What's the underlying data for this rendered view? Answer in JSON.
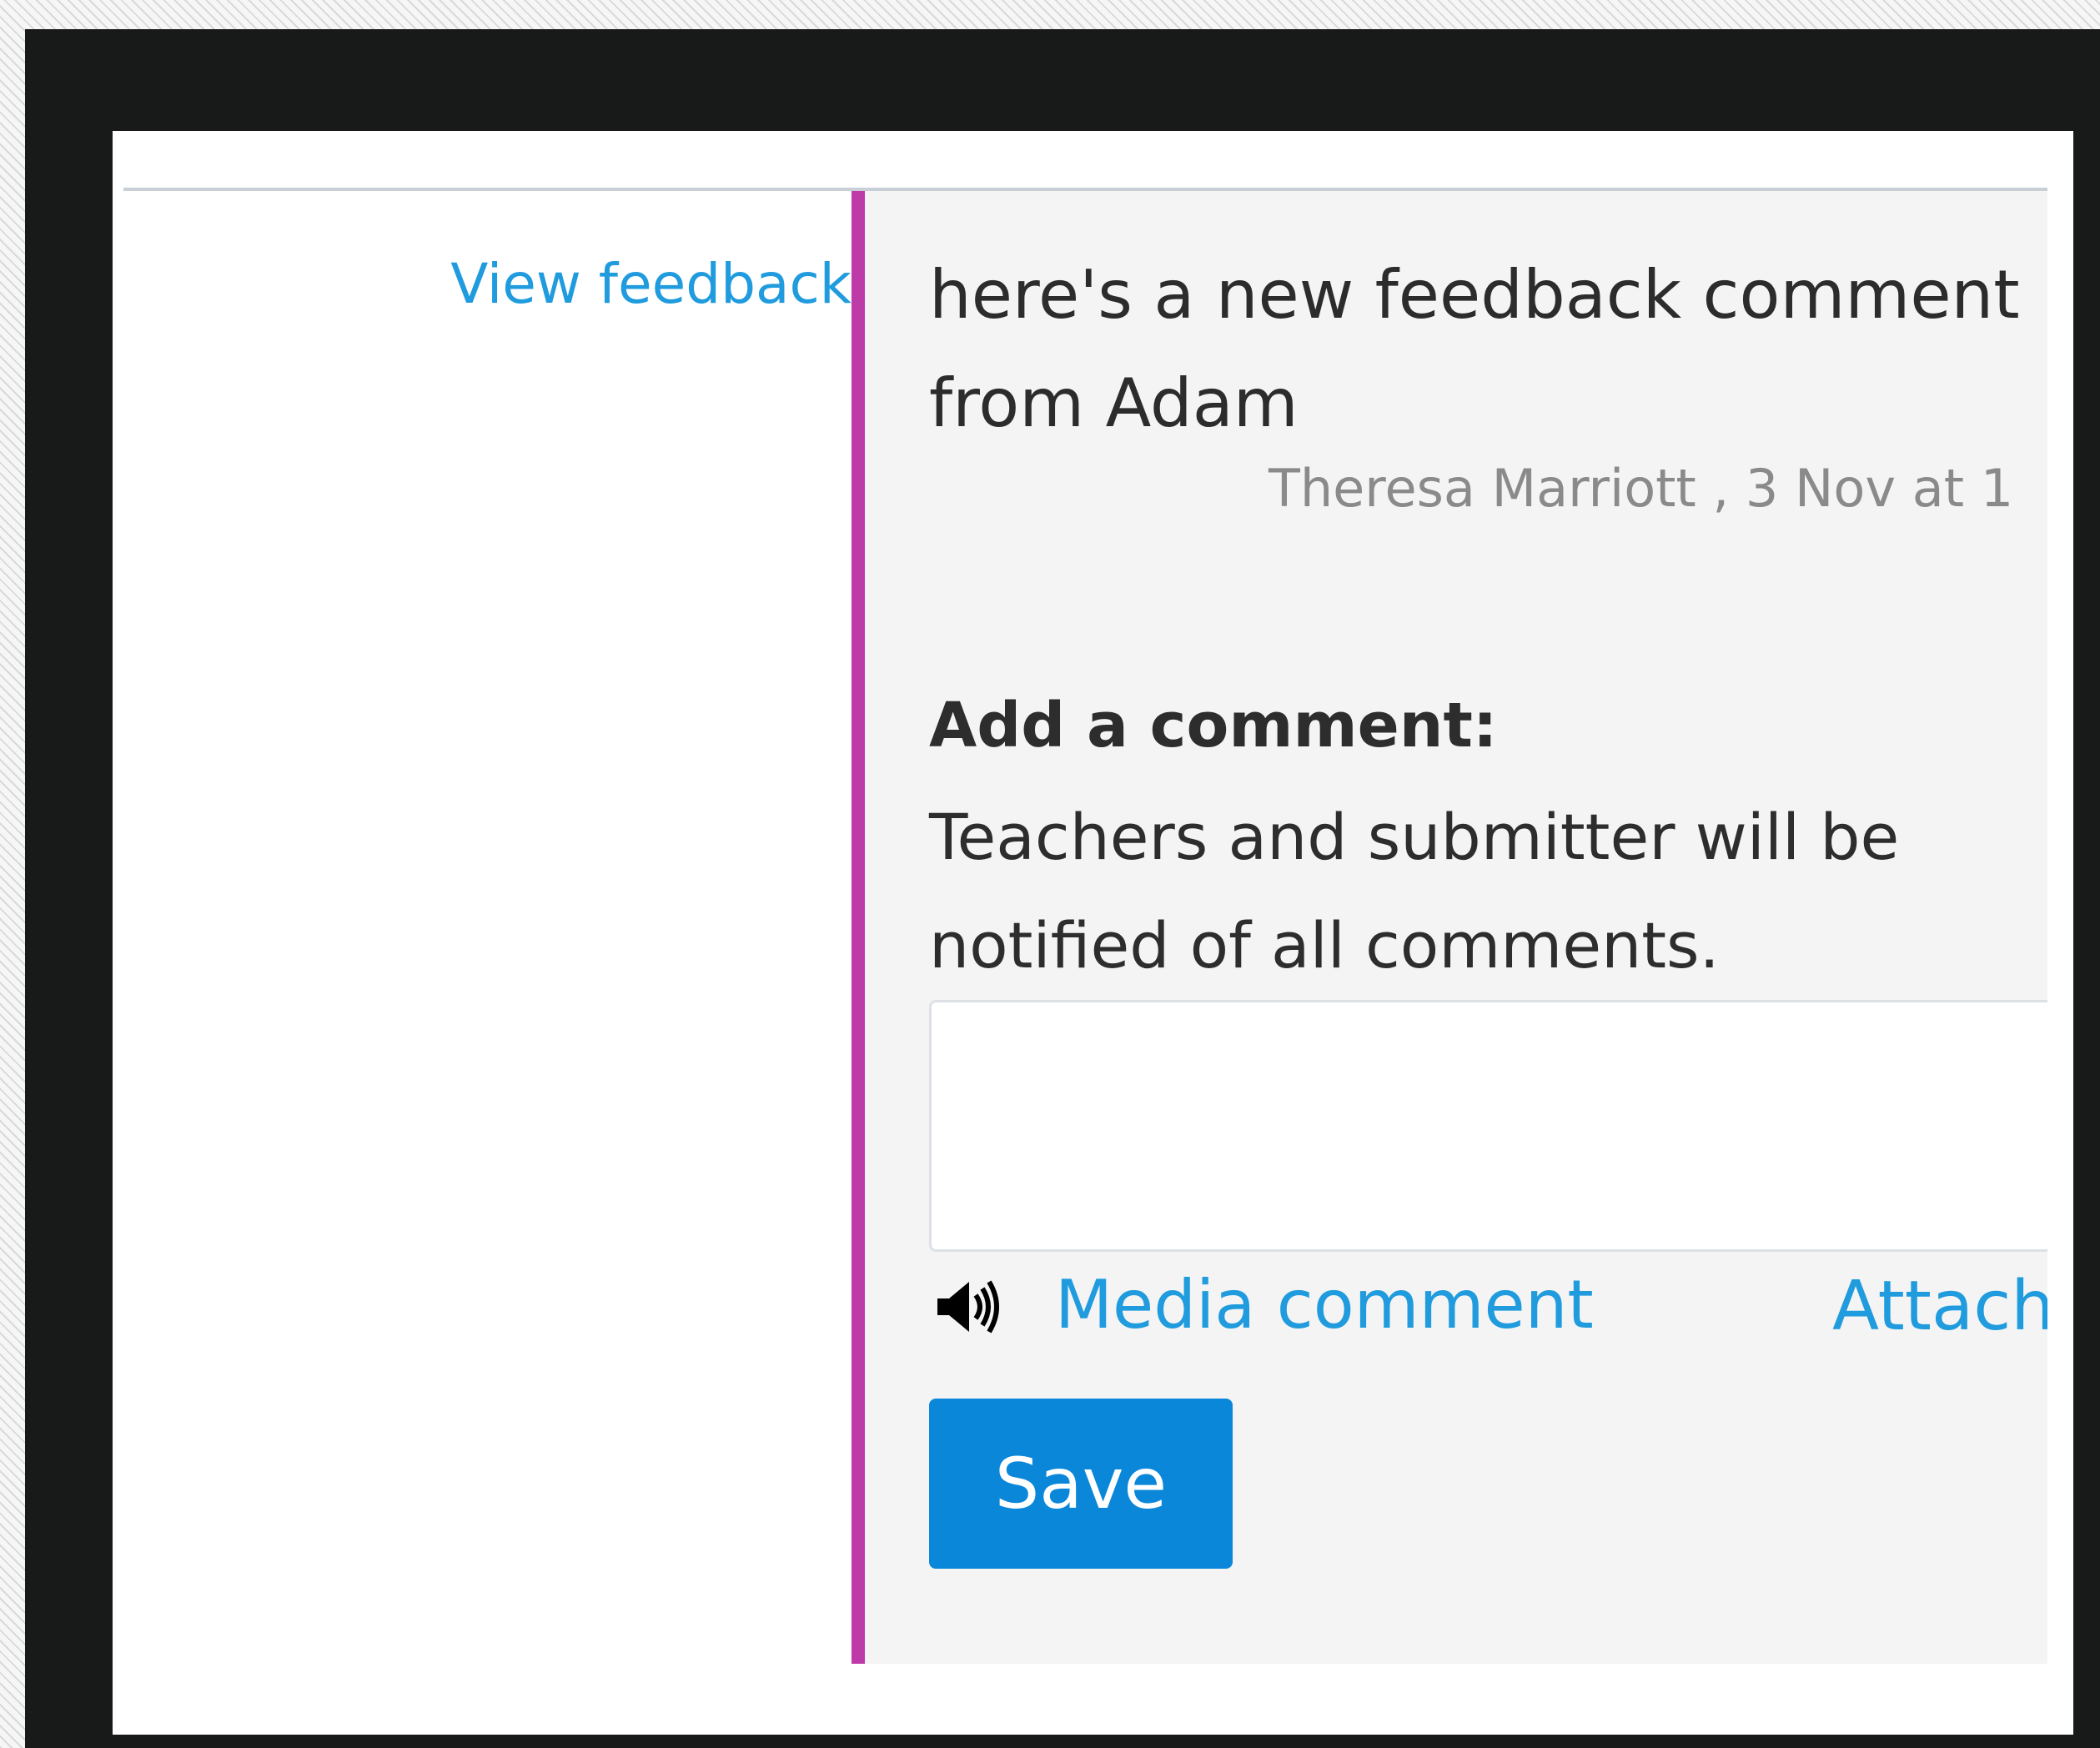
{
  "left": {
    "view_feedback": "View feedback"
  },
  "comment": {
    "body": "here's a new feedback comment from Adam",
    "meta": "Theresa Marriott , 3 Nov at 1"
  },
  "add_comment": {
    "heading": "Add a comment:",
    "notice": "Teachers and submitter will be notified of all comments.",
    "input_value": "",
    "media_icon": "speaker-icon",
    "media_label": "Media comment",
    "attach_label": "Attach",
    "save_label": "Save"
  },
  "colors": {
    "link": "#1f9bde",
    "accent_bar": "#bd3aa8",
    "save_button": "#0b87d9",
    "frame": "#181a19"
  }
}
